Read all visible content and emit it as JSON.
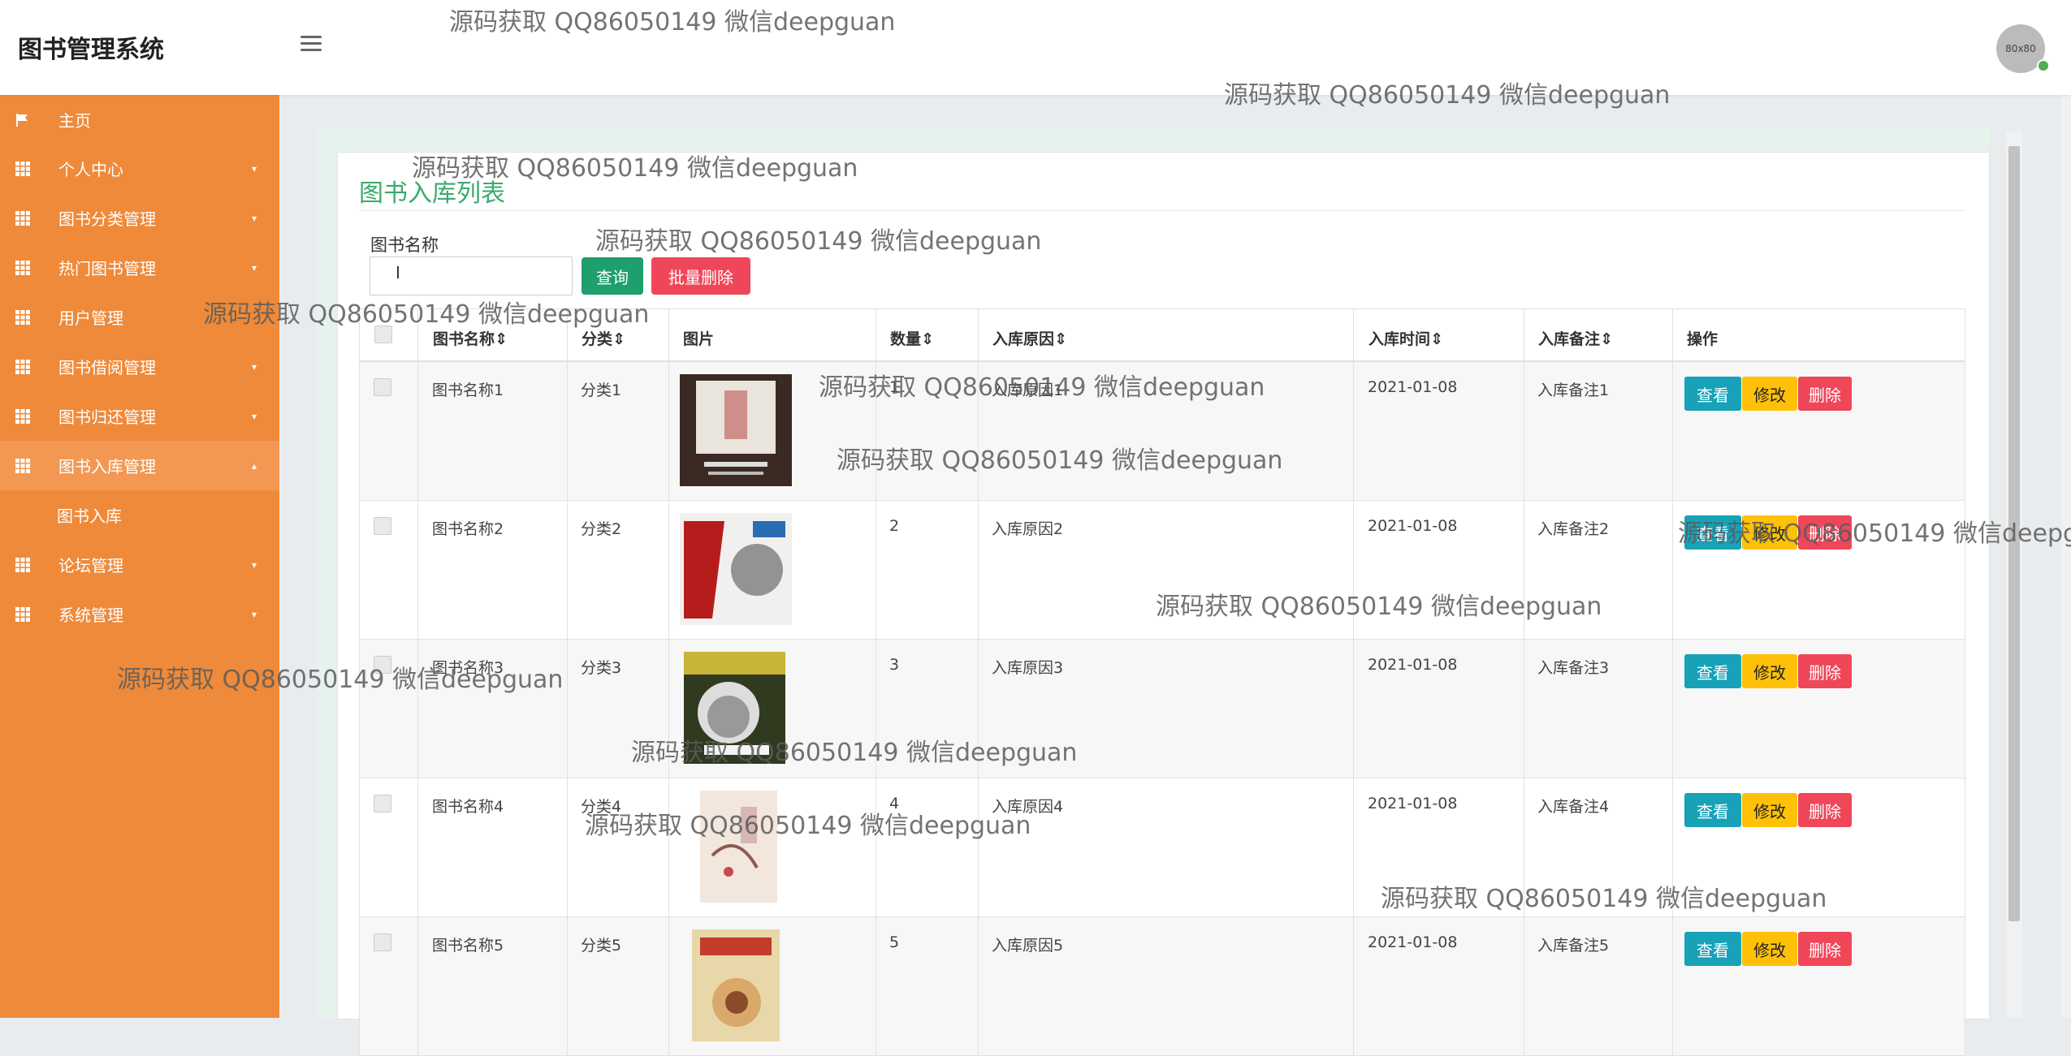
{
  "app": {
    "title": "图书管理系统",
    "avatar_text": "80x80"
  },
  "sidebar": {
    "items": [
      {
        "label": "主页",
        "icon": "flag-icon"
      },
      {
        "label": "个人中心",
        "icon": "grid-icon"
      },
      {
        "label": "图书分类管理",
        "icon": "grid-icon"
      },
      {
        "label": "热门图书管理",
        "icon": "grid-icon"
      },
      {
        "label": "用户管理",
        "icon": "grid-icon"
      },
      {
        "label": "图书借阅管理",
        "icon": "grid-icon"
      },
      {
        "label": "图书归还管理",
        "icon": "grid-icon"
      },
      {
        "label": "图书入库管理",
        "icon": "grid-icon"
      },
      {
        "label": "图书入库",
        "icon": ""
      },
      {
        "label": "论坛管理",
        "icon": "grid-icon"
      },
      {
        "label": "系统管理",
        "icon": "grid-icon"
      }
    ]
  },
  "page": {
    "title": "图书入库列表",
    "search_label": "图书名称",
    "search_value": "",
    "query_button": "查询",
    "batch_delete_button": "批量删除"
  },
  "table": {
    "columns": [
      "图书名称",
      "分类",
      "图片",
      "数量",
      "入库原因",
      "入库时间",
      "入库备注",
      "操作"
    ],
    "rows": [
      {
        "name": "图书名称1",
        "category": "分类1",
        "qty": "1",
        "reason": "入库原因1",
        "date": "2021-01-08",
        "note": "入库备注1"
      },
      {
        "name": "图书名称2",
        "category": "分类2",
        "qty": "2",
        "reason": "入库原因2",
        "date": "2021-01-08",
        "note": "入库备注2"
      },
      {
        "name": "图书名称3",
        "category": "分类3",
        "qty": "3",
        "reason": "入库原因3",
        "date": "2021-01-08",
        "note": "入库备注3"
      },
      {
        "name": "图书名称4",
        "category": "分类4",
        "qty": "4",
        "reason": "入库原因4",
        "date": "2021-01-08",
        "note": "入库备注4"
      },
      {
        "name": "图书名称5",
        "category": "分类5",
        "qty": "5",
        "reason": "入库原因5",
        "date": "2021-01-08",
        "note": "入库备注5"
      }
    ],
    "row_actions": {
      "view": "查看",
      "edit": "修改",
      "delete": "删除"
    }
  },
  "watermark": {
    "text": "源码获取 QQ86050149 微信deepguan"
  },
  "colors": {
    "sidebar": "#ef8a3a",
    "title_green": "#3aaa6d",
    "query_btn": "#1f9e6e",
    "danger": "#f0465a",
    "info": "#17a2b8",
    "warning": "#ffc107"
  }
}
